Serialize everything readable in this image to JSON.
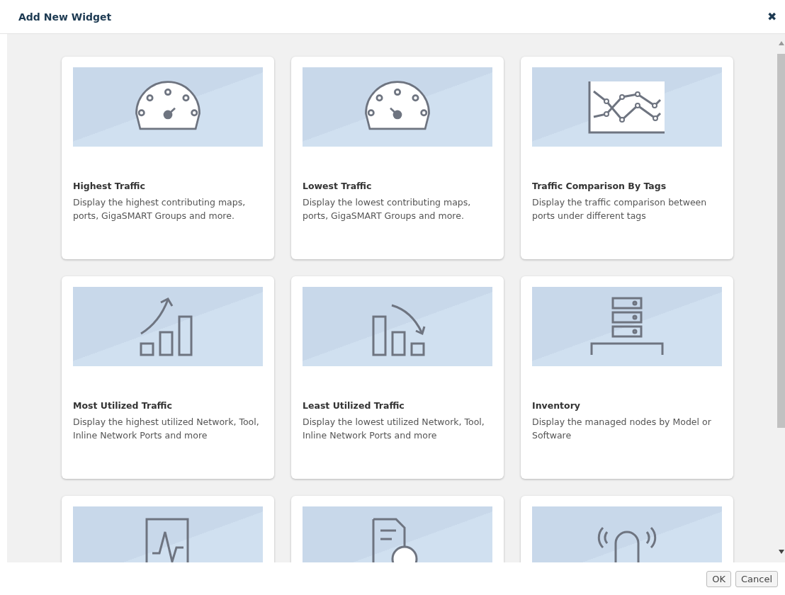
{
  "dialog": {
    "title": "Add New Widget",
    "close": "✖"
  },
  "widgets": [
    {
      "kind": "gauge-high",
      "title": "Highest Traffic",
      "description": "Display the highest contributing maps, ports, GigaSMART Groups and more."
    },
    {
      "kind": "gauge-low",
      "title": "Lowest Traffic",
      "description": "Display the lowest contributing maps, ports, GigaSMART Groups and more."
    },
    {
      "kind": "line-chart",
      "title": "Traffic Comparison By Tags",
      "description": "Display the traffic comparison between ports under different tags"
    },
    {
      "kind": "bars-up",
      "title": "Most Utilized Traffic",
      "description": "Display the highest utilized Network, Tool, Inline Network Ports and more"
    },
    {
      "kind": "bars-down",
      "title": "Least Utilized Traffic",
      "description": "Display the lowest utilized Network, Tool, Inline Network Ports and more"
    },
    {
      "kind": "server",
      "title": "Inventory",
      "description": "Display the managed nodes by Model or Software"
    },
    {
      "kind": "pulse"
    },
    {
      "kind": "document"
    },
    {
      "kind": "alarm"
    }
  ],
  "buttons": [
    "OK",
    "Cancel"
  ]
}
